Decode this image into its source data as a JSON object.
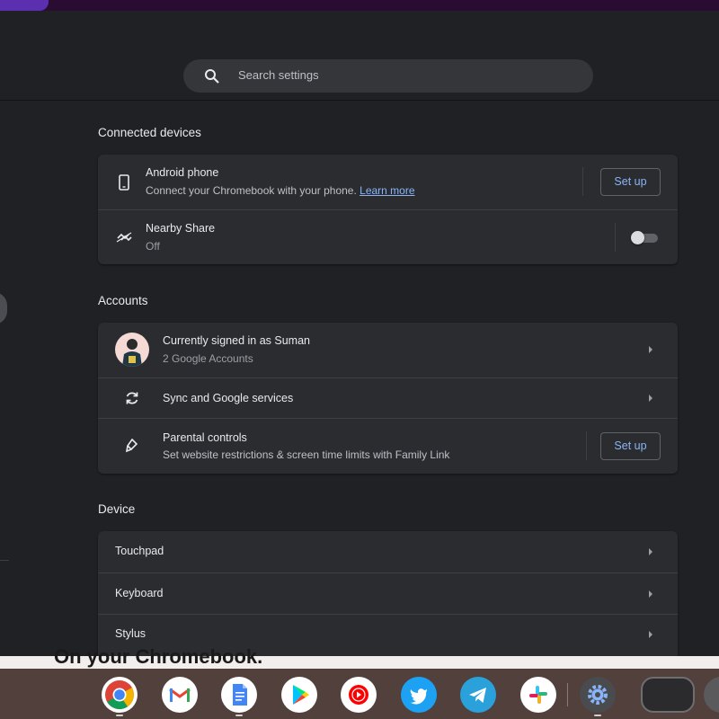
{
  "search": {
    "placeholder": "Search settings"
  },
  "sections": {
    "connected_devices": {
      "title": "Connected devices",
      "android": {
        "title": "Android phone",
        "subtitle": "Connect your Chromebook with your phone.",
        "link": "Learn more",
        "button": "Set up"
      },
      "nearby": {
        "title": "Nearby Share",
        "status": "Off",
        "enabled": false
      }
    },
    "accounts": {
      "title": "Accounts",
      "signed_in": {
        "title": "Currently signed in as Suman",
        "subtitle": "2 Google Accounts"
      },
      "sync": {
        "title": "Sync and Google services"
      },
      "parental": {
        "title": "Parental controls",
        "subtitle": "Set website restrictions & screen time limits with Family Link",
        "button": "Set up"
      }
    },
    "device": {
      "title": "Device",
      "items": [
        {
          "label": "Touchpad"
        },
        {
          "label": "Keyboard"
        },
        {
          "label": "Stylus"
        }
      ]
    }
  },
  "overlay": {
    "caption": "On your Chromebook."
  },
  "shelf": {
    "apps": [
      {
        "icon": "chrome-icon",
        "running": true
      },
      {
        "icon": "gmail-icon",
        "running": false
      },
      {
        "icon": "google-docs-icon",
        "running": true
      },
      {
        "icon": "play-store-icon",
        "running": false
      },
      {
        "icon": "youtube-music-icon",
        "running": false
      },
      {
        "icon": "twitter-icon",
        "running": false
      },
      {
        "icon": "telegram-icon",
        "running": false
      },
      {
        "icon": "slack-icon",
        "running": false
      },
      {
        "icon": "settings-icon",
        "running": true
      }
    ]
  },
  "colors": {
    "background": "#202124",
    "card": "#2b2c2f",
    "accent": "#8ab4f8",
    "text": "#e8eaed",
    "secondary_text": "#9aa0a6"
  }
}
